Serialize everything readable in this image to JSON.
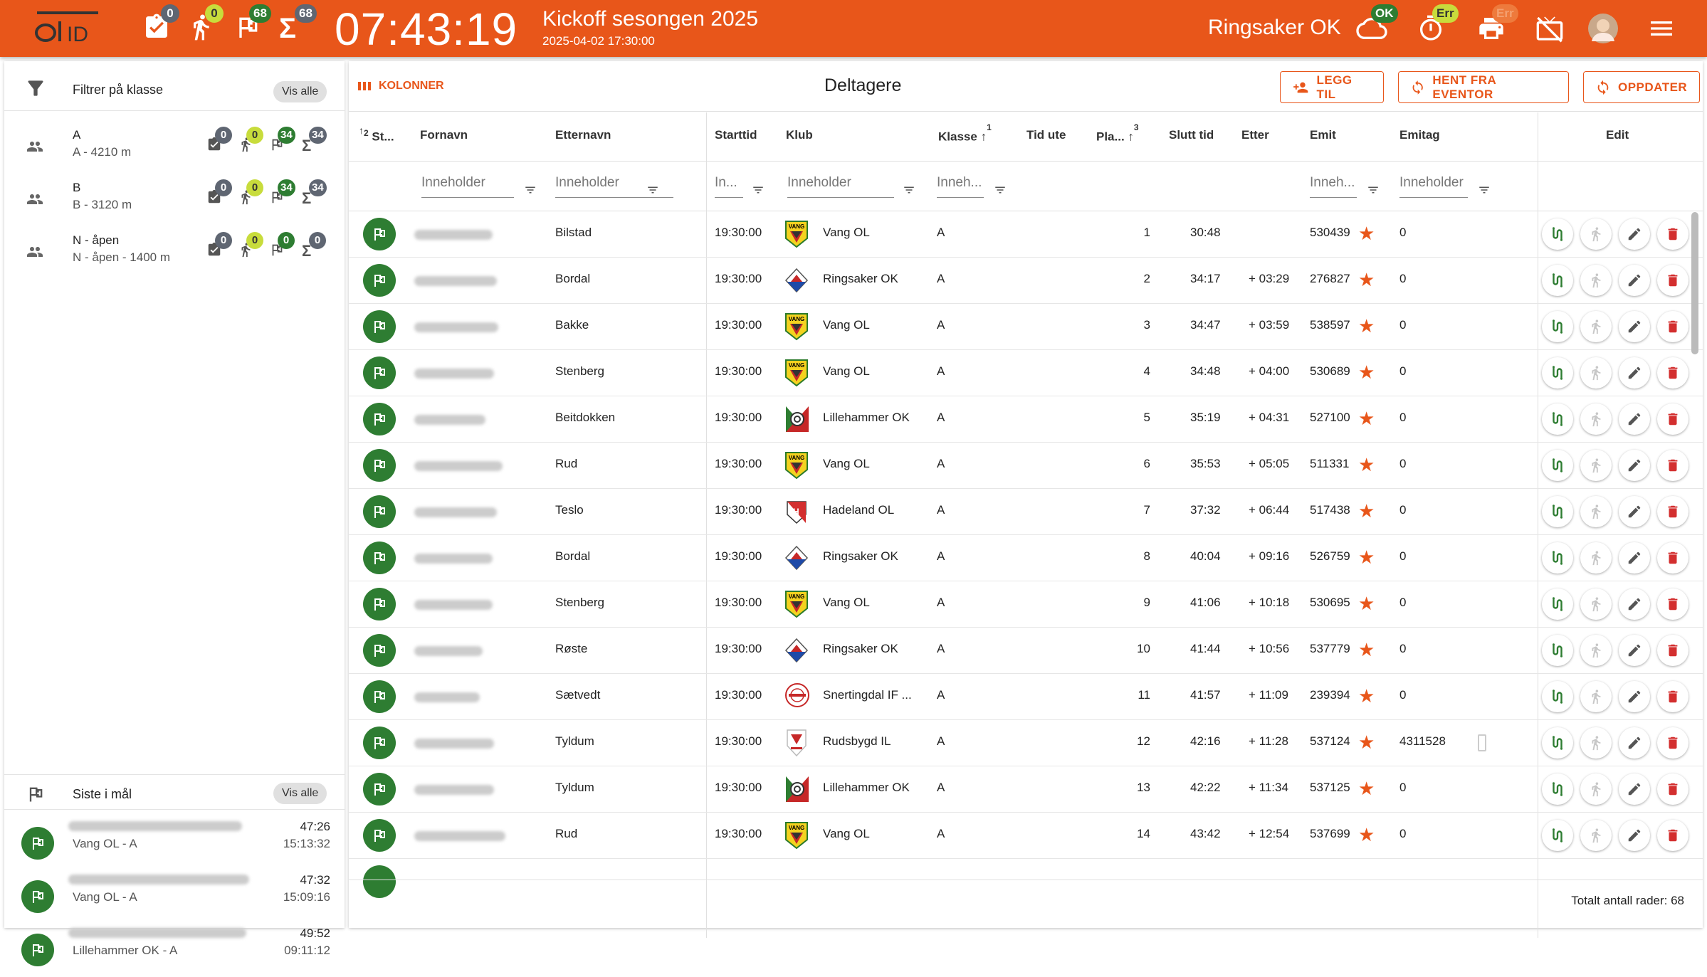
{
  "header": {
    "logo_text": "OTID",
    "clock": "07:43:19",
    "event_title": "Kickoff sesongen 2025",
    "event_date": "2025-04-02 17:30:00",
    "club_name": "Ringsaker OK",
    "counters": {
      "registered": "0",
      "running": "0",
      "finished": "68",
      "total": "68"
    },
    "cloud_status": "OK",
    "timer_status": "Err",
    "printer_status": "Err",
    "accent": "#e8561a"
  },
  "left": {
    "filter_title": "Filtrer på klasse",
    "show_all_label": "Vis alle",
    "classes": [
      {
        "name": "A",
        "sub": "A - 4210 m",
        "c1": "0",
        "c2": "0",
        "c3": "34",
        "c4": "34"
      },
      {
        "name": "B",
        "sub": "B - 3120 m",
        "c1": "0",
        "c2": "0",
        "c3": "34",
        "c4": "34"
      },
      {
        "name": "N - åpen",
        "sub": "N - åpen - 1400 m",
        "c1": "0",
        "c2": "0",
        "c3": "0",
        "c4": "0"
      }
    ],
    "finish_title": "Siste i mål",
    "finish_show_all": "Vis alle",
    "finishers": [
      {
        "sub": "Vang OL - A",
        "time": "47:26",
        "clock": "15:13:32"
      },
      {
        "sub": "Vang OL - A",
        "time": "47:32",
        "clock": "15:09:16"
      },
      {
        "sub": "Lillehammer OK - A",
        "time": "49:52",
        "clock": "09:11:12"
      }
    ]
  },
  "main": {
    "columns_label": "KOLONNER",
    "title": "Deltagere",
    "add_label": "LEGG TIL",
    "eventor_label": "HENT FRA EVENTOR",
    "refresh_label": "OPPDATER",
    "headers": {
      "status": "St...",
      "status_sort": "2",
      "first": "Fornavn",
      "last": "Etternavn",
      "start": "Starttid",
      "club": "Klub",
      "class": "Klasse",
      "class_sort": "1",
      "time_out": "Tid ute",
      "place": "Pla...",
      "place_sort": "3",
      "finish": "Slutt tid",
      "after": "Etter",
      "emit": "Emit",
      "emitag": "Emitag",
      "edit": "Edit"
    },
    "filters": {
      "first": "Inneholder",
      "last": "Inneholder",
      "start": "In...",
      "club": "Inneholder",
      "class": "Inneh...",
      "emit": "Inneh...",
      "emitag": "Inneholder"
    },
    "rows": [
      {
        "last": "Bilstad",
        "start": "19:30:00",
        "club": "Vang OL",
        "cls": "A",
        "place": "1",
        "finish": "30:48",
        "after": "",
        "emit": "530439",
        "emitag": "0"
      },
      {
        "last": "Bordal",
        "start": "19:30:00",
        "club": "Ringsaker OK",
        "cls": "A",
        "place": "2",
        "finish": "34:17",
        "after": "+ 03:29",
        "emit": "276827",
        "emitag": "0"
      },
      {
        "last": "Bakke",
        "start": "19:30:00",
        "club": "Vang OL",
        "cls": "A",
        "place": "3",
        "finish": "34:47",
        "after": "+ 03:59",
        "emit": "538597",
        "emitag": "0"
      },
      {
        "last": "Stenberg",
        "start": "19:30:00",
        "club": "Vang OL",
        "cls": "A",
        "place": "4",
        "finish": "34:48",
        "after": "+ 04:00",
        "emit": "530689",
        "emitag": "0"
      },
      {
        "last": "Beitdokken",
        "start": "19:30:00",
        "club": "Lillehammer OK",
        "cls": "A",
        "place": "5",
        "finish": "35:19",
        "after": "+ 04:31",
        "emit": "527100",
        "emitag": "0"
      },
      {
        "last": "Rud",
        "start": "19:30:00",
        "club": "Vang OL",
        "cls": "A",
        "place": "6",
        "finish": "35:53",
        "after": "+ 05:05",
        "emit": "511331",
        "emitag": "0"
      },
      {
        "last": "Teslo",
        "start": "19:30:00",
        "club": "Hadeland OL",
        "cls": "A",
        "place": "7",
        "finish": "37:32",
        "after": "+ 06:44",
        "emit": "517438",
        "emitag": "0"
      },
      {
        "last": "Bordal",
        "start": "19:30:00",
        "club": "Ringsaker OK",
        "cls": "A",
        "place": "8",
        "finish": "40:04",
        "after": "+ 09:16",
        "emit": "526759",
        "emitag": "0"
      },
      {
        "last": "Stenberg",
        "start": "19:30:00",
        "club": "Vang OL",
        "cls": "A",
        "place": "9",
        "finish": "41:06",
        "after": "+ 10:18",
        "emit": "530695",
        "emitag": "0"
      },
      {
        "last": "Røste",
        "start": "19:30:00",
        "club": "Ringsaker OK",
        "cls": "A",
        "place": "10",
        "finish": "41:44",
        "after": "+ 10:56",
        "emit": "537779",
        "emitag": "0"
      },
      {
        "last": "Sætvedt",
        "start": "19:30:00",
        "club": "Snertingdal IF ...",
        "cls": "A",
        "place": "11",
        "finish": "41:57",
        "after": "+ 11:09",
        "emit": "239394",
        "emitag": "0"
      },
      {
        "last": "Tyldum",
        "start": "19:30:00",
        "club": "Rudsbygd IL",
        "cls": "A",
        "place": "12",
        "finish": "42:16",
        "after": "+ 11:28",
        "emit": "537124",
        "emitag": "4311528"
      },
      {
        "last": "Tyldum",
        "start": "19:30:00",
        "club": "Lillehammer OK",
        "cls": "A",
        "place": "13",
        "finish": "42:22",
        "after": "+ 11:34",
        "emit": "537125",
        "emitag": "0"
      },
      {
        "last": "Rud",
        "start": "19:30:00",
        "club": "Vang OL",
        "cls": "A",
        "place": "14",
        "finish": "43:42",
        "after": "+ 12:54",
        "emit": "537699",
        "emitag": "0"
      }
    ],
    "total_label": "Totalt antall rader: 68"
  }
}
